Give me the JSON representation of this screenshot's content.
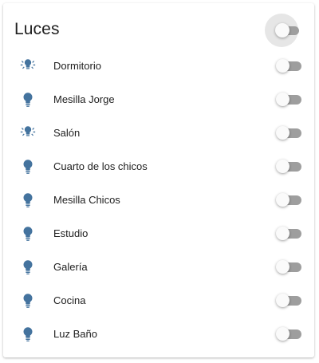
{
  "card": {
    "title": "Luces",
    "group_toggle_on": false
  },
  "colors": {
    "icon": "#44739e",
    "text": "#212121",
    "toggle_track": "#9e9e9e",
    "toggle_thumb": "#fafafa"
  },
  "entities": [
    {
      "label": "Dormitorio",
      "icon": "ceiling-lamp-group-icon",
      "on": false
    },
    {
      "label": "Mesilla Jorge",
      "icon": "lightbulb-icon",
      "on": false
    },
    {
      "label": "Salón",
      "icon": "ceiling-lamp-group-icon",
      "on": false
    },
    {
      "label": "Cuarto de los chicos",
      "icon": "lightbulb-icon",
      "on": false
    },
    {
      "label": "Mesilla Chicos",
      "icon": "lightbulb-icon",
      "on": false
    },
    {
      "label": "Estudio",
      "icon": "lightbulb-icon",
      "on": false
    },
    {
      "label": "Galería",
      "icon": "lightbulb-icon",
      "on": false
    },
    {
      "label": "Cocina",
      "icon": "lightbulb-icon",
      "on": false
    },
    {
      "label": "Luz Baño",
      "icon": "lightbulb-icon",
      "on": false
    }
  ]
}
